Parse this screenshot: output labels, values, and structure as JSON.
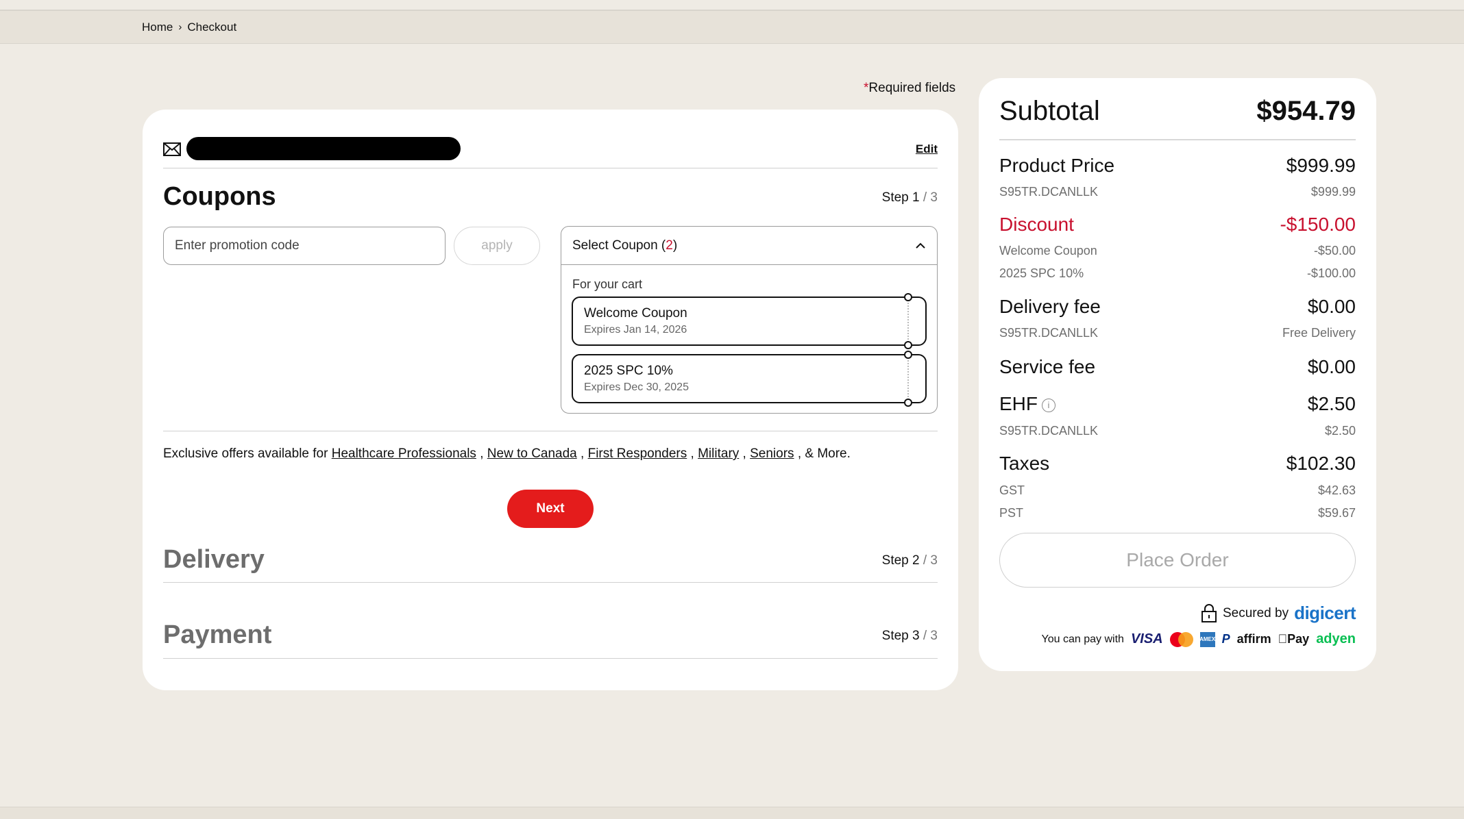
{
  "breadcrumb": {
    "home": "Home",
    "separator": "›",
    "current": "Checkout"
  },
  "required_note": {
    "star": "*",
    "text": "Required fields"
  },
  "email": {
    "edit_label": "Edit"
  },
  "coupons": {
    "title": "Coupons",
    "step_label": "Step",
    "step_current": "1",
    "step_total": "/ 3",
    "promo_placeholder": "Enter promotion code",
    "apply_label": "apply",
    "select": {
      "label": "Select Coupon (",
      "count": "2",
      "suffix": ")"
    },
    "for_cart": "For your cart",
    "items": [
      {
        "name": "Welcome Coupon",
        "expires": "Expires Jan 14, 2026"
      },
      {
        "name": "2025 SPC 10%",
        "expires": "Expires Dec 30, 2025"
      }
    ],
    "offers": {
      "prefix": "Exclusive offers available for",
      "links": [
        "Healthcare Professionals",
        "New to Canada",
        "First Responders",
        "Military",
        "Seniors"
      ],
      "suffix": ", & More."
    },
    "next_label": "Next"
  },
  "delivery": {
    "title": "Delivery",
    "step_label": "Step",
    "step_current": "2",
    "step_total": "/ 3"
  },
  "payment": {
    "title": "Payment",
    "step_label": "Step",
    "step_current": "3",
    "step_total": "/ 3"
  },
  "summary": {
    "subtotal_label": "Subtotal",
    "subtotal_value": "$954.79",
    "product_price_label": "Product Price",
    "product_price_value": "$999.99",
    "product_sku": "S95TR.DCANLLK",
    "product_sku_value": "$999.99",
    "discount_label": "Discount",
    "discount_value": "-$150.00",
    "discount_items": [
      {
        "label": "Welcome Coupon",
        "value": "-$50.00"
      },
      {
        "label": "2025 SPC 10%",
        "value": "-$100.00"
      }
    ],
    "delivery_label": "Delivery fee",
    "delivery_value": "$0.00",
    "delivery_sku": "S95TR.DCANLLK",
    "delivery_sku_value": "Free Delivery",
    "service_label": "Service fee",
    "service_value": "$0.00",
    "ehf_label": "EHF",
    "ehf_info": "i",
    "ehf_value": "$2.50",
    "ehf_sku": "S95TR.DCANLLK",
    "ehf_sku_value": "$2.50",
    "taxes_label": "Taxes",
    "taxes_value": "$102.30",
    "gst_label": "GST",
    "gst_value": "$42.63",
    "pst_label": "PST",
    "pst_value": "$59.67",
    "place_order_label": "Place Order",
    "secured_label": "Secured by",
    "secured_brand": "digicert",
    "pay_with_label": "You can pay with",
    "pay_logos": {
      "visa": "VISA",
      "amex": "AMEX",
      "paypal": "P",
      "affirm": "affirm",
      "applepay": "Pay",
      "adyen": "adyen"
    }
  },
  "colors": {
    "accent_red": "#e41c1c",
    "discount_red": "#c8102e",
    "digicert_blue": "#1a73c8",
    "background": "#efebe4"
  },
  "icons": [
    "mail-icon",
    "chevron-up-icon",
    "info-icon",
    "lock-icon",
    "chevron-right-icon"
  ]
}
